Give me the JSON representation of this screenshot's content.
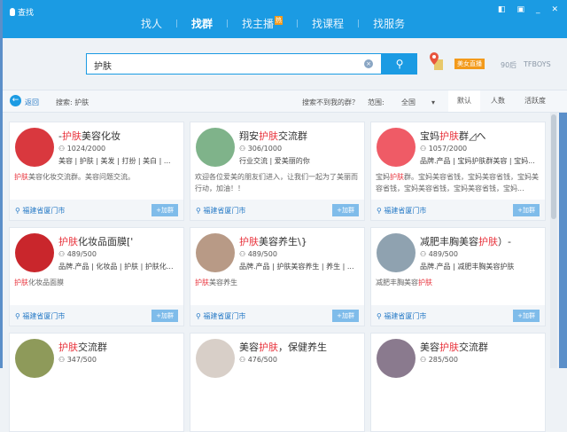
{
  "window": {
    "title": "查找",
    "controls": [
      "◧",
      "▣",
      "_",
      "✕"
    ]
  },
  "tabs": [
    {
      "label": "找人"
    },
    {
      "label": "找群",
      "active": true
    },
    {
      "label": "找主播",
      "badge": "热"
    },
    {
      "label": "找课程"
    },
    {
      "label": "找服务"
    }
  ],
  "search": {
    "value": "护肤",
    "clear_icon": "×",
    "button_icon": "⚲"
  },
  "hot": {
    "live": "美女直播",
    "tag1": "90后",
    "tag2": "TFBOYS"
  },
  "toolbar": {
    "back": "返回",
    "search_label": "搜索: 护肤",
    "not_found": "搜索不到我的群？",
    "range_label": "范围:",
    "range_value": "全国",
    "sort": [
      "默认",
      "人数",
      "活跃度"
    ]
  },
  "colors": {
    "accent": "#1b9be3",
    "highlight": "#e8343d"
  },
  "cards": [
    {
      "title_pre": "-",
      "title_hl": "护肤",
      "title_post": "美容化妆",
      "count": "1024/2000",
      "tags": "美容 | 护肤 | 美发 | 打扮 | 美白 | ...",
      "desc_pre": "",
      "desc_hl": "护肤",
      "desc_post": "美容化妆交流群。美容问题交流。",
      "location": "福建省厦门市",
      "join": "+加群",
      "avatar": "#d9383e"
    },
    {
      "title_pre": "翔安",
      "title_hl": "护肤",
      "title_post": "交流群",
      "count": "306/1000",
      "tags": "行业交流 | 爱美丽的你",
      "desc_pre": "欢迎各位爱美的朋友们进入，让我们一起为了美丽而行动，加油！！",
      "desc_hl": "",
      "desc_post": "",
      "location": "福建省厦门市",
      "join": "+加群",
      "avatar": "#7fb38a"
    },
    {
      "title_pre": "宝妈",
      "title_hl": "护肤",
      "title_post": "群◿へ",
      "count": "1057/2000",
      "tags": "品牌.产品 | 宝妈护肤群美容 | 宝妈...",
      "desc_pre": "宝妈",
      "desc_hl": "护肤",
      "desc_post": "群。宝妈美容省钱，宝妈美容省钱，宝妈美容省钱，宝妈美容省钱，宝妈美容省钱，宝妈...",
      "location": "福建省厦门市",
      "join": "+加群",
      "avatar": "#ef5b66"
    },
    {
      "title_pre": "",
      "title_hl": "护肤",
      "title_post": "化妆品面膜['",
      "count": "489/500",
      "tags": "品牌.产品 | 化妆品 | 护肤 | 护肤化...",
      "desc_pre": "",
      "desc_hl": "护肤",
      "desc_post": "化妆品面膜",
      "location": "福建省厦门市",
      "join": "+加群",
      "avatar": "#c9262c"
    },
    {
      "title_pre": "",
      "title_hl": "护肤",
      "title_post": "美容养生\\}",
      "count": "489/500",
      "tags": "品牌.产品 | 护肤美容养生 | 养生 | ...",
      "desc_pre": "",
      "desc_hl": "护肤",
      "desc_post": "美容养生",
      "location": "福建省厦门市",
      "join": "+加群",
      "avatar": "#b89a86"
    },
    {
      "title_pre": "减肥丰胸美容",
      "title_hl": "护肤",
      "title_post": "）-",
      "count": "489/500",
      "tags": "品牌.产品 | 减肥丰胸美容护肤",
      "desc_pre": "减肥丰胸美容",
      "desc_hl": "护肤",
      "desc_post": "",
      "location": "福建省厦门市",
      "join": "+加群",
      "avatar": "#8fa2b0"
    },
    {
      "title_pre": "",
      "title_hl": "护肤",
      "title_post": "交流群",
      "count": "347/500",
      "tags": "",
      "desc_pre": "",
      "desc_hl": "",
      "desc_post": "",
      "location": "",
      "join": "",
      "avatar": "#8e9a5a"
    },
    {
      "title_pre": "美容",
      "title_hl": "护肤",
      "title_post": "，保健养生",
      "count": "476/500",
      "tags": "",
      "desc_pre": "",
      "desc_hl": "",
      "desc_post": "",
      "location": "",
      "join": "",
      "avatar": "#d8cfc8"
    },
    {
      "title_pre": "美容",
      "title_hl": "护肤",
      "title_post": "交流群",
      "count": "285/500",
      "tags": "",
      "desc_pre": "",
      "desc_hl": "",
      "desc_post": "",
      "location": "",
      "join": "",
      "avatar": "#8a7a8e"
    }
  ]
}
